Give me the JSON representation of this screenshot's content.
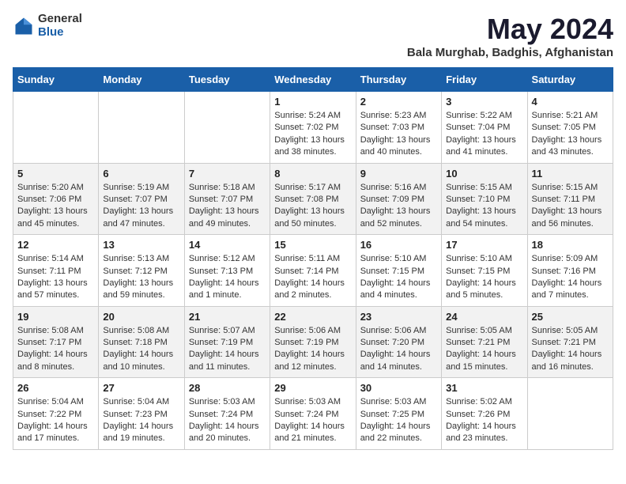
{
  "header": {
    "logo_general": "General",
    "logo_blue": "Blue",
    "month_title": "May 2024",
    "location": "Bala Murghab, Badghis, Afghanistan"
  },
  "weekdays": [
    "Sunday",
    "Monday",
    "Tuesday",
    "Wednesday",
    "Thursday",
    "Friday",
    "Saturday"
  ],
  "weeks": [
    [
      {
        "day": "",
        "sunrise": "",
        "sunset": "",
        "daylight": ""
      },
      {
        "day": "",
        "sunrise": "",
        "sunset": "",
        "daylight": ""
      },
      {
        "day": "",
        "sunrise": "",
        "sunset": "",
        "daylight": ""
      },
      {
        "day": "1",
        "sunrise": "Sunrise: 5:24 AM",
        "sunset": "Sunset: 7:02 PM",
        "daylight": "Daylight: 13 hours and 38 minutes."
      },
      {
        "day": "2",
        "sunrise": "Sunrise: 5:23 AM",
        "sunset": "Sunset: 7:03 PM",
        "daylight": "Daylight: 13 hours and 40 minutes."
      },
      {
        "day": "3",
        "sunrise": "Sunrise: 5:22 AM",
        "sunset": "Sunset: 7:04 PM",
        "daylight": "Daylight: 13 hours and 41 minutes."
      },
      {
        "day": "4",
        "sunrise": "Sunrise: 5:21 AM",
        "sunset": "Sunset: 7:05 PM",
        "daylight": "Daylight: 13 hours and 43 minutes."
      }
    ],
    [
      {
        "day": "5",
        "sunrise": "Sunrise: 5:20 AM",
        "sunset": "Sunset: 7:06 PM",
        "daylight": "Daylight: 13 hours and 45 minutes."
      },
      {
        "day": "6",
        "sunrise": "Sunrise: 5:19 AM",
        "sunset": "Sunset: 7:07 PM",
        "daylight": "Daylight: 13 hours and 47 minutes."
      },
      {
        "day": "7",
        "sunrise": "Sunrise: 5:18 AM",
        "sunset": "Sunset: 7:07 PM",
        "daylight": "Daylight: 13 hours and 49 minutes."
      },
      {
        "day": "8",
        "sunrise": "Sunrise: 5:17 AM",
        "sunset": "Sunset: 7:08 PM",
        "daylight": "Daylight: 13 hours and 50 minutes."
      },
      {
        "day": "9",
        "sunrise": "Sunrise: 5:16 AM",
        "sunset": "Sunset: 7:09 PM",
        "daylight": "Daylight: 13 hours and 52 minutes."
      },
      {
        "day": "10",
        "sunrise": "Sunrise: 5:15 AM",
        "sunset": "Sunset: 7:10 PM",
        "daylight": "Daylight: 13 hours and 54 minutes."
      },
      {
        "day": "11",
        "sunrise": "Sunrise: 5:15 AM",
        "sunset": "Sunset: 7:11 PM",
        "daylight": "Daylight: 13 hours and 56 minutes."
      }
    ],
    [
      {
        "day": "12",
        "sunrise": "Sunrise: 5:14 AM",
        "sunset": "Sunset: 7:11 PM",
        "daylight": "Daylight: 13 hours and 57 minutes."
      },
      {
        "day": "13",
        "sunrise": "Sunrise: 5:13 AM",
        "sunset": "Sunset: 7:12 PM",
        "daylight": "Daylight: 13 hours and 59 minutes."
      },
      {
        "day": "14",
        "sunrise": "Sunrise: 5:12 AM",
        "sunset": "Sunset: 7:13 PM",
        "daylight": "Daylight: 14 hours and 1 minute."
      },
      {
        "day": "15",
        "sunrise": "Sunrise: 5:11 AM",
        "sunset": "Sunset: 7:14 PM",
        "daylight": "Daylight: 14 hours and 2 minutes."
      },
      {
        "day": "16",
        "sunrise": "Sunrise: 5:10 AM",
        "sunset": "Sunset: 7:15 PM",
        "daylight": "Daylight: 14 hours and 4 minutes."
      },
      {
        "day": "17",
        "sunrise": "Sunrise: 5:10 AM",
        "sunset": "Sunset: 7:15 PM",
        "daylight": "Daylight: 14 hours and 5 minutes."
      },
      {
        "day": "18",
        "sunrise": "Sunrise: 5:09 AM",
        "sunset": "Sunset: 7:16 PM",
        "daylight": "Daylight: 14 hours and 7 minutes."
      }
    ],
    [
      {
        "day": "19",
        "sunrise": "Sunrise: 5:08 AM",
        "sunset": "Sunset: 7:17 PM",
        "daylight": "Daylight: 14 hours and 8 minutes."
      },
      {
        "day": "20",
        "sunrise": "Sunrise: 5:08 AM",
        "sunset": "Sunset: 7:18 PM",
        "daylight": "Daylight: 14 hours and 10 minutes."
      },
      {
        "day": "21",
        "sunrise": "Sunrise: 5:07 AM",
        "sunset": "Sunset: 7:19 PM",
        "daylight": "Daylight: 14 hours and 11 minutes."
      },
      {
        "day": "22",
        "sunrise": "Sunrise: 5:06 AM",
        "sunset": "Sunset: 7:19 PM",
        "daylight": "Daylight: 14 hours and 12 minutes."
      },
      {
        "day": "23",
        "sunrise": "Sunrise: 5:06 AM",
        "sunset": "Sunset: 7:20 PM",
        "daylight": "Daylight: 14 hours and 14 minutes."
      },
      {
        "day": "24",
        "sunrise": "Sunrise: 5:05 AM",
        "sunset": "Sunset: 7:21 PM",
        "daylight": "Daylight: 14 hours and 15 minutes."
      },
      {
        "day": "25",
        "sunrise": "Sunrise: 5:05 AM",
        "sunset": "Sunset: 7:21 PM",
        "daylight": "Daylight: 14 hours and 16 minutes."
      }
    ],
    [
      {
        "day": "26",
        "sunrise": "Sunrise: 5:04 AM",
        "sunset": "Sunset: 7:22 PM",
        "daylight": "Daylight: 14 hours and 17 minutes."
      },
      {
        "day": "27",
        "sunrise": "Sunrise: 5:04 AM",
        "sunset": "Sunset: 7:23 PM",
        "daylight": "Daylight: 14 hours and 19 minutes."
      },
      {
        "day": "28",
        "sunrise": "Sunrise: 5:03 AM",
        "sunset": "Sunset: 7:24 PM",
        "daylight": "Daylight: 14 hours and 20 minutes."
      },
      {
        "day": "29",
        "sunrise": "Sunrise: 5:03 AM",
        "sunset": "Sunset: 7:24 PM",
        "daylight": "Daylight: 14 hours and 21 minutes."
      },
      {
        "day": "30",
        "sunrise": "Sunrise: 5:03 AM",
        "sunset": "Sunset: 7:25 PM",
        "daylight": "Daylight: 14 hours and 22 minutes."
      },
      {
        "day": "31",
        "sunrise": "Sunrise: 5:02 AM",
        "sunset": "Sunset: 7:26 PM",
        "daylight": "Daylight: 14 hours and 23 minutes."
      },
      {
        "day": "",
        "sunrise": "",
        "sunset": "",
        "daylight": ""
      }
    ]
  ]
}
